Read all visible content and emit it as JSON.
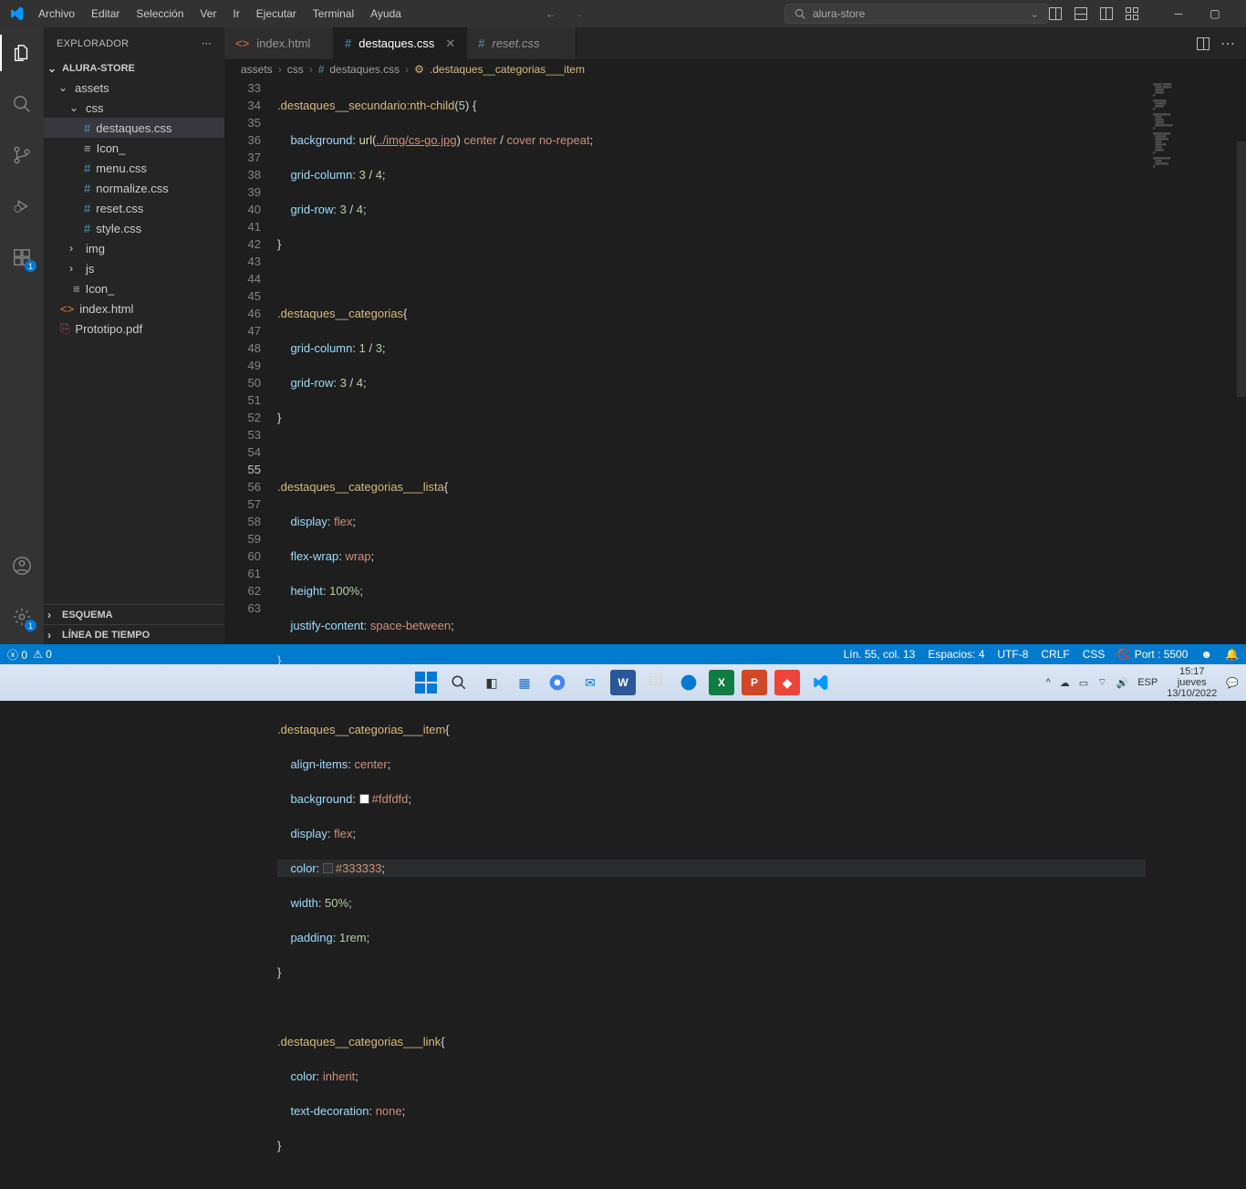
{
  "menu": {
    "archivo": "Archivo",
    "editar": "Editar",
    "seleccion": "Selección",
    "ver": "Ver",
    "ir": "Ir",
    "ejecutar": "Ejecutar",
    "terminal": "Terminal",
    "ayuda": "Ayuda"
  },
  "search": {
    "placeholder": "alura-store"
  },
  "explorer": {
    "title": "EXPLORADOR",
    "root": "ALURA-STORE",
    "assets": "assets",
    "css": "css",
    "files": {
      "destaques": "destaques.css",
      "icon1": "Icon_",
      "menu": "menu.css",
      "normalize": "normalize.css",
      "reset": "reset.css",
      "style": "style.css",
      "img": "img",
      "js": "js",
      "icon2": "Icon_",
      "index": "index.html",
      "pdf": "Prototipo.pdf"
    },
    "esquema": "ESQUEMA",
    "timeline": "LÍNEA DE TIEMPO"
  },
  "tabs": {
    "index": "index.html",
    "destaques": "destaques.css",
    "reset": "reset.css"
  },
  "breadcrumb": {
    "p1": "assets",
    "p2": "css",
    "p3": "destaques.css",
    "p4": ".destaques__categorias___item"
  },
  "lines": [
    "33",
    "34",
    "35",
    "36",
    "37",
    "38",
    "39",
    "40",
    "41",
    "42",
    "43",
    "44",
    "45",
    "46",
    "47",
    "48",
    "49",
    "50",
    "51",
    "52",
    "53",
    "54",
    "55",
    "56",
    "57",
    "58",
    "59",
    "60",
    "61",
    "62",
    "63"
  ],
  "code": {
    "l33a": ".destaques__secundario:nth-child",
    "l33b": "(",
    "l33c": "5",
    "l33d": ") {",
    "l34a": "background",
    "l34b": ": ",
    "l34c": "url",
    "l34d": "(",
    "l34e": "../img/cs-go.jpg",
    "l34f": ") ",
    "l34g": "center",
    "l34h": " / ",
    "l34i": "cover",
    "l34j": " ",
    "l34k": "no-repeat",
    "l34l": ";",
    "l35a": "grid-column",
    "l35b": ": ",
    "l35c": "3",
    "l35d": " / ",
    "l35e": "4",
    "l35f": ";",
    "l36a": "grid-row",
    "l36b": ": ",
    "l36c": "3",
    "l36d": " / ",
    "l36e": "4",
    "l36f": ";",
    "l37": "}",
    "l39a": ".destaques__categorias",
    "l39b": "{",
    "l40a": "grid-column",
    "l40b": ": ",
    "l40c": "1",
    "l40d": " / ",
    "l40e": "3",
    "l40f": ";",
    "l41a": "grid-row",
    "l41b": ": ",
    "l41c": "3",
    "l41d": " / ",
    "l41e": "4",
    "l41f": ";",
    "l42": "}",
    "l44a": ".destaques__categorias___lista",
    "l44b": "{",
    "l45a": "display",
    "l45b": ": ",
    "l45c": "flex",
    "l45d": ";",
    "l46a": "flex-wrap",
    "l46b": ": ",
    "l46c": "wrap",
    "l46d": ";",
    "l47a": "height",
    "l47b": ": ",
    "l47c": "100%",
    "l47d": ";",
    "l48a": "justify-content",
    "l48b": ": ",
    "l48c": "space-between",
    "l48d": ";",
    "l49": "}",
    "l51a": ".destaques__categorias___item",
    "l51b": "{",
    "l52a": "align-items",
    "l52b": ": ",
    "l52c": "center",
    "l52d": ";",
    "l53a": "background",
    "l53b": ": ",
    "l53c": "#fdfdfd",
    "l53d": ";",
    "l54a": "display",
    "l54b": ": ",
    "l54c": "flex",
    "l54d": ";",
    "l55a": "color",
    "l55b": ": ",
    "l55c": "#333333",
    "l55d": ";",
    "l56a": "width",
    "l56b": ": ",
    "l56c": "50%",
    "l56d": ";",
    "l57a": "padding",
    "l57b": ": ",
    "l57c": "1rem",
    "l57d": ";",
    "l58": "}",
    "l60a": ".destaques__categorias___link",
    "l60b": "{",
    "l61a": "color",
    "l61b": ": ",
    "l61c": "inherit",
    "l61d": ";",
    "l62a": "text-decoration",
    "l62b": ": ",
    "l62c": "none",
    "l62d": ";",
    "l63": "}"
  },
  "status": {
    "errors": "0",
    "warnings": "0",
    "position": "Lín. 55, col. 13",
    "spaces": "Espacios: 4",
    "encoding": "UTF-8",
    "eol": "CRLF",
    "lang": "CSS",
    "port": "Port : 5500"
  },
  "tray": {
    "lang": "ESP",
    "time": "15:17",
    "day": "jueves",
    "date": "13/10/2022"
  },
  "activitybar": {
    "ext_badge": "1",
    "settings_badge": "1"
  }
}
